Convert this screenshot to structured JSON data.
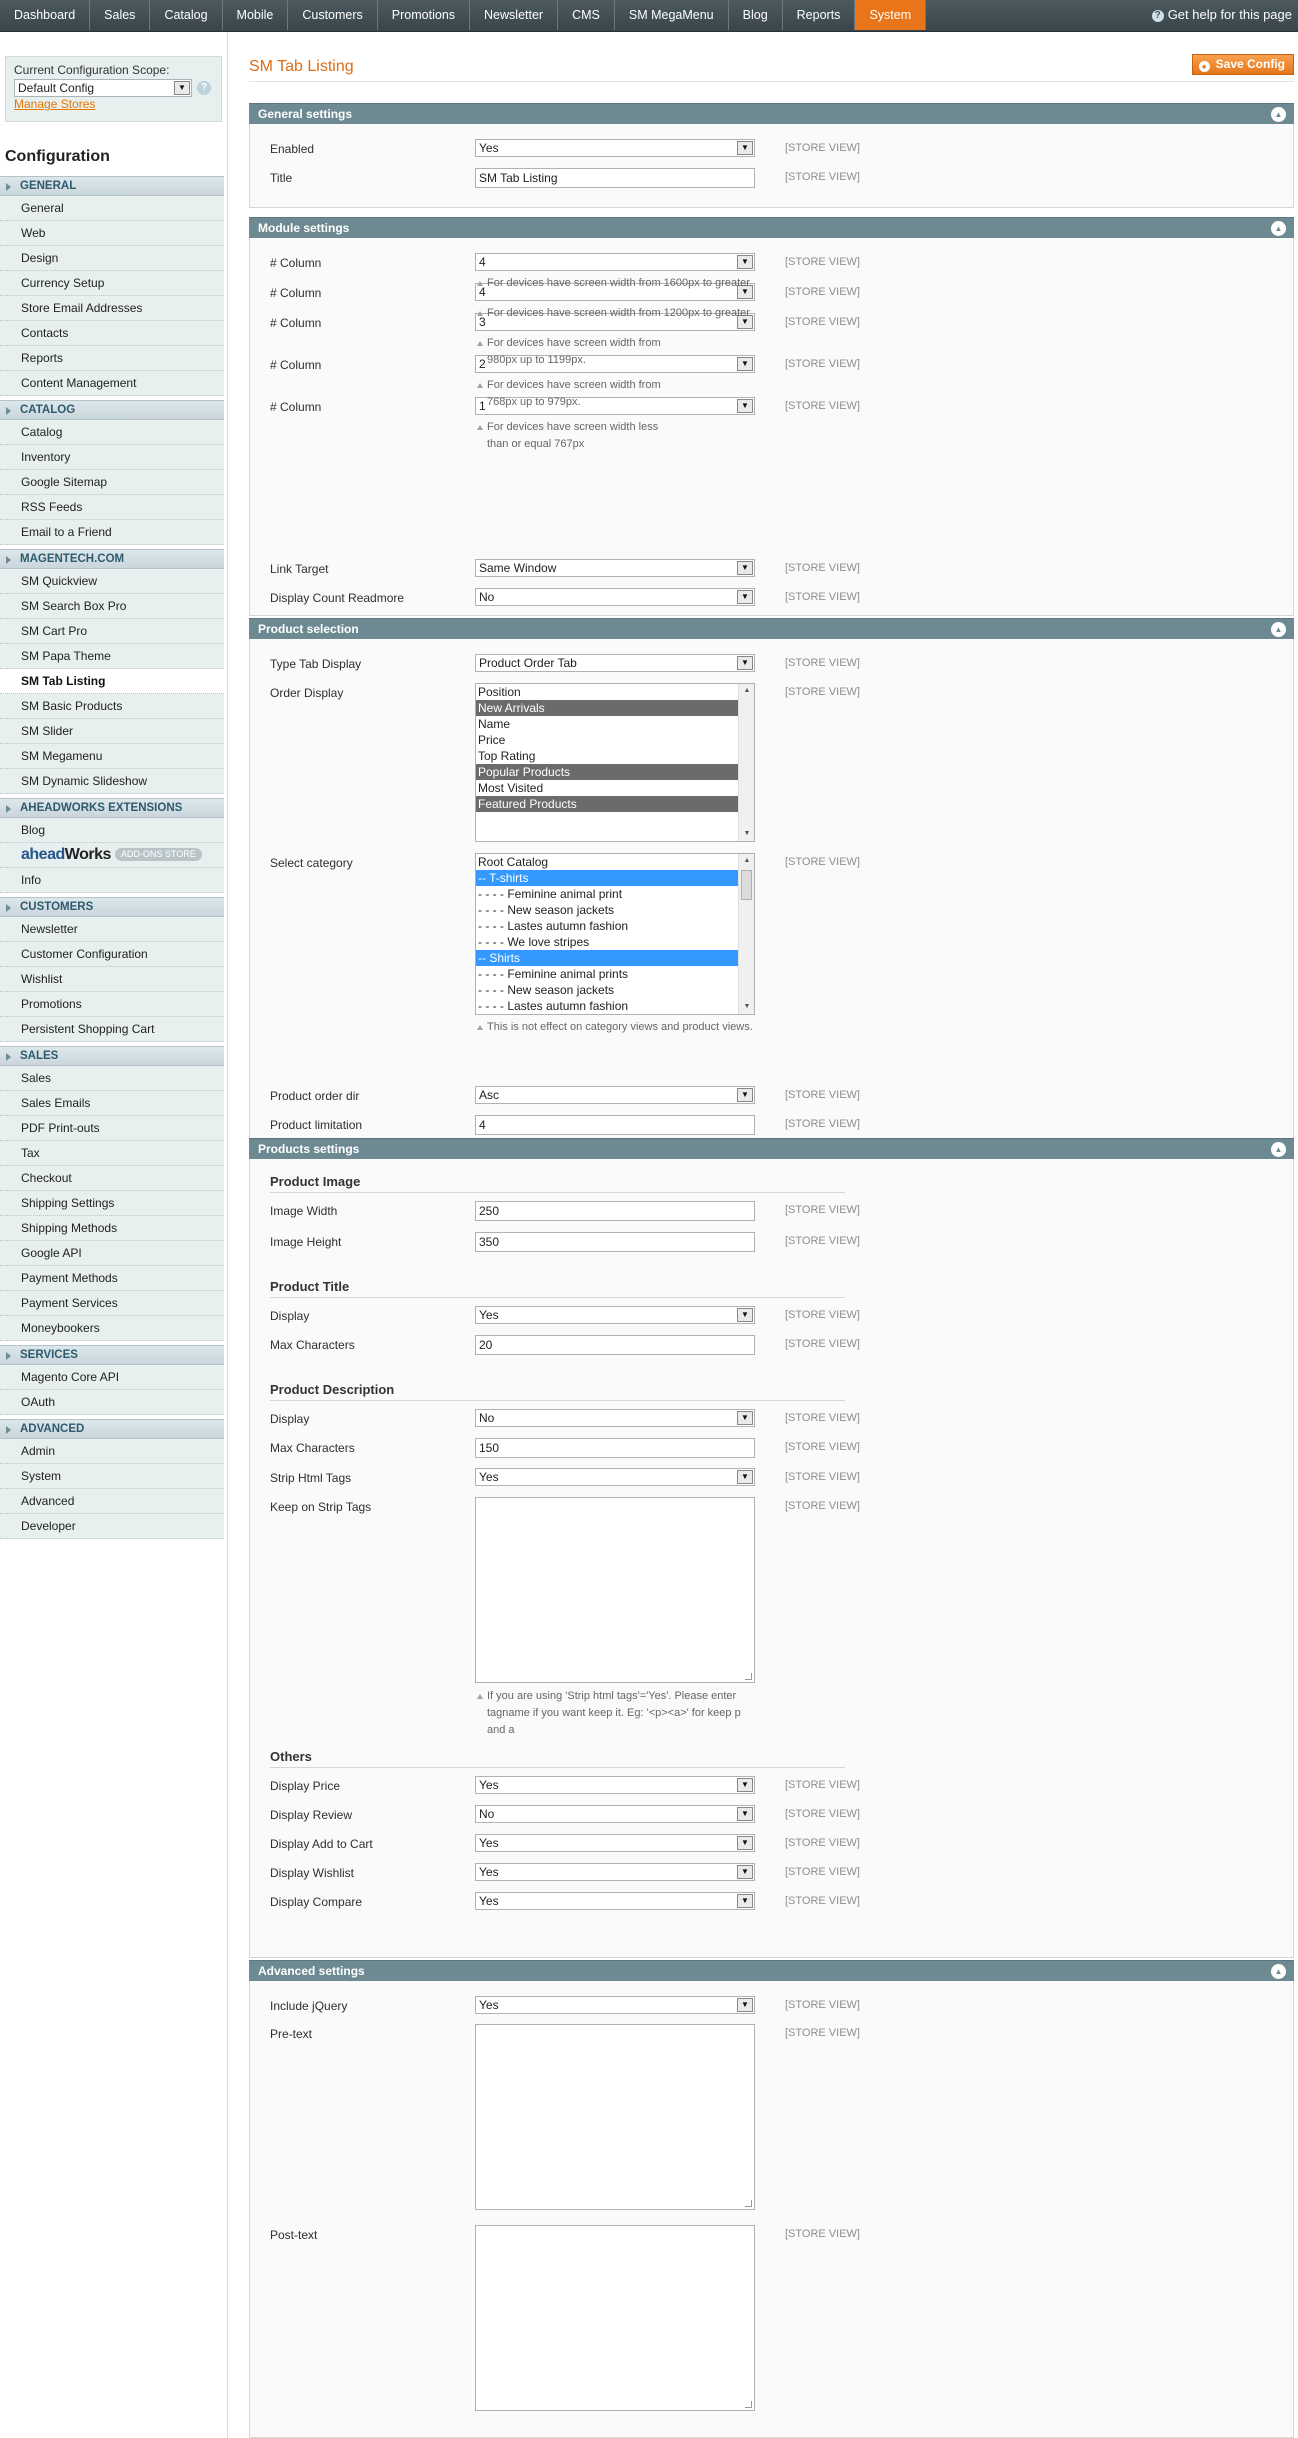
{
  "topnav": {
    "items": [
      "Dashboard",
      "Sales",
      "Catalog",
      "Mobile",
      "Customers",
      "Promotions",
      "Newsletter",
      "CMS",
      "SM MegaMenu",
      "Blog",
      "Reports",
      "System"
    ],
    "active": "System",
    "help": "Get help for this page"
  },
  "sidebar": {
    "scope_label": "Current Configuration Scope:",
    "scope_value": "Default Config",
    "manage_stores": "Manage Stores",
    "title": "Configuration",
    "sections": [
      {
        "title": "GENERAL",
        "items": [
          "General",
          "Web",
          "Design",
          "Currency Setup",
          "Store Email Addresses",
          "Contacts",
          "Reports",
          "Content Management"
        ]
      },
      {
        "title": "CATALOG",
        "items": [
          "Catalog",
          "Inventory",
          "Google Sitemap",
          "RSS Feeds",
          "Email to a Friend"
        ]
      },
      {
        "title": "MAGENTECH.COM",
        "items": [
          "SM Quickview",
          "SM Search Box Pro",
          "SM Cart Pro",
          "SM Papa Theme",
          "SM Tab Listing",
          "SM Basic Products",
          "SM Slider",
          "SM Megamenu",
          "SM Dynamic Slideshow"
        ]
      },
      {
        "title": "AHEADWORKS EXTENSIONS",
        "items": [
          "Blog",
          "aheadWorks ADD-ONS STORE",
          "Info"
        ]
      },
      {
        "title": "CUSTOMERS",
        "items": [
          "Newsletter",
          "Customer Configuration",
          "Wishlist",
          "Promotions",
          "Persistent Shopping Cart"
        ]
      },
      {
        "title": "SALES",
        "items": [
          "Sales",
          "Sales Emails",
          "PDF Print-outs",
          "Tax",
          "Checkout",
          "Shipping Settings",
          "Shipping Methods",
          "Google API",
          "Payment Methods",
          "Payment Services",
          "Moneybookers"
        ]
      },
      {
        "title": "SERVICES",
        "items": [
          "Magento Core API",
          "OAuth"
        ]
      },
      {
        "title": "ADVANCED",
        "items": [
          "Admin",
          "System",
          "Advanced",
          "Developer"
        ]
      }
    ],
    "current": "SM Tab Listing",
    "aheadworks": {
      "part1": "ahead",
      "part2": "Works",
      "pill": "ADD-ONS STORE"
    }
  },
  "page": {
    "title": "SM Tab Listing",
    "save_label": "Save Config"
  },
  "scope_tag": "[STORE VIEW]",
  "general": {
    "title": "General settings",
    "enabled_label": "Enabled",
    "enabled": "Yes",
    "title_label": "Title",
    "title_value": "SM Tab Listing"
  },
  "module": {
    "title": "Module settings",
    "col_label": "# Column",
    "cols": [
      {
        "value": "4",
        "note": "For devices have screen width from 1600px to greater."
      },
      {
        "value": "4",
        "note": "For devices have screen width from 1200px to greater."
      },
      {
        "value": "3",
        "note": "For devices have screen width from 980px up to 1199px."
      },
      {
        "value": "2",
        "note": "For devices have screen width from 768px up to 979px."
      },
      {
        "value": "1",
        "note": "For devices have screen width less than or equal 767px"
      }
    ],
    "link_target_label": "Link Target",
    "link_target": "Same Window",
    "readmore_label": "Display Count Readmore",
    "readmore": "No"
  },
  "selection": {
    "title": "Product selection",
    "type_label": "Type Tab Display",
    "type": "Product Order Tab",
    "order_label": "Order Display",
    "order_options": [
      "Position",
      "New Arrivals",
      "Name",
      "Price",
      "Top Rating",
      "Popular Products",
      "Most Visited",
      "Featured Products"
    ],
    "order_selected": [
      "New Arrivals",
      "Popular Products",
      "Featured Products"
    ],
    "cat_label": "Select category",
    "categories": [
      "Root Catalog",
      "-- T-shirts",
      "- - - - Feminine animal print",
      "- - - - New season jackets",
      "- - - - Lastes autumn fashion",
      "- - - - We love stripes",
      "-- Shirts",
      "- - - - Feminine animal prints",
      "- - - - New season jackets",
      "- - - - Lastes autumn fashion"
    ],
    "cat_selected": [
      "-- T-shirts",
      "-- Shirts"
    ],
    "cat_note": "This is not effect on category views and product views.",
    "dir_label": "Product order dir",
    "dir": "Asc",
    "limit_label": "Product limitation",
    "limit": "4"
  },
  "products": {
    "title": "Products settings",
    "img_h": "Product Image",
    "img_w_label": "Image Width",
    "img_w": "250",
    "img_h_label": "Image Height",
    "img_ht": "350",
    "ttl_h": "Product Title",
    "ttl_display_label": "Display",
    "ttl_display": "Yes",
    "ttl_max_label": "Max Characters",
    "ttl_max": "20",
    "desc_h": "Product Description",
    "desc_display_label": "Display",
    "desc_display": "No",
    "desc_max_label": "Max Characters",
    "desc_max": "150",
    "strip_label": "Strip Html Tags",
    "strip": "Yes",
    "keep_label": "Keep on Strip Tags",
    "keep_note": "If you are using 'Strip html tags'='Yes'. Please enter tagname if you want keep it. Eg: '<p><a>' for keep p and a",
    "others_h": "Others",
    "others": [
      {
        "label": "Display Price",
        "value": "Yes"
      },
      {
        "label": "Display Review",
        "value": "No"
      },
      {
        "label": "Display Add to Cart",
        "value": "Yes"
      },
      {
        "label": "Display Wishlist",
        "value": "Yes"
      },
      {
        "label": "Display Compare",
        "value": "Yes"
      }
    ]
  },
  "advanced": {
    "title": "Advanced settings",
    "jquery_label": "Include jQuery",
    "jquery": "Yes",
    "pretext_label": "Pre-text",
    "posttext_label": "Post-text"
  }
}
